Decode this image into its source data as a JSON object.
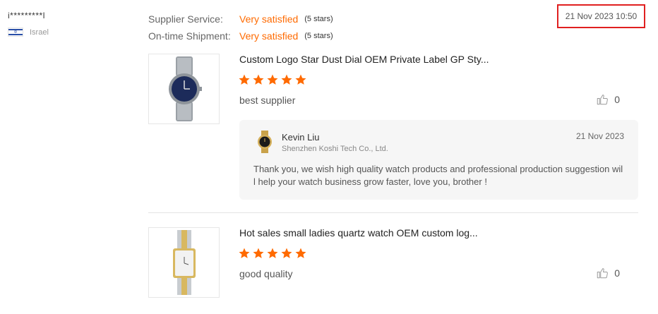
{
  "reviewer": {
    "name": "i*********l",
    "country": "Israel",
    "flag_icon": "israel-flag-icon"
  },
  "ratings": [
    {
      "label": "Supplier Service:",
      "value": "Very satisfied",
      "stars": "(5 stars)"
    },
    {
      "label": "On-time Shipment:",
      "value": "Very satisfied",
      "stars": "(5 stars)"
    }
  ],
  "review_date": "21 Nov 2023 10:50",
  "reviews": [
    {
      "product_title": "Custom Logo Star Dust Dial OEM Private Label GP Sty...",
      "rating": 5,
      "comment": "best supplier",
      "likes": "0",
      "reply": {
        "name": "Kevin Liu",
        "company": "Shenzhen Koshi Tech Co., Ltd.",
        "date": "21 Nov 2023",
        "text": "Thank you, we wish high quality watch products and professional production suggestion will help your watch business grow faster, love you, brother !"
      }
    },
    {
      "product_title": "Hot sales small ladies quartz watch OEM custom log...",
      "rating": 5,
      "comment": "good quality",
      "likes": "0"
    }
  ],
  "colors": {
    "accent": "#ff6a00",
    "highlight_border": "#e02020"
  }
}
